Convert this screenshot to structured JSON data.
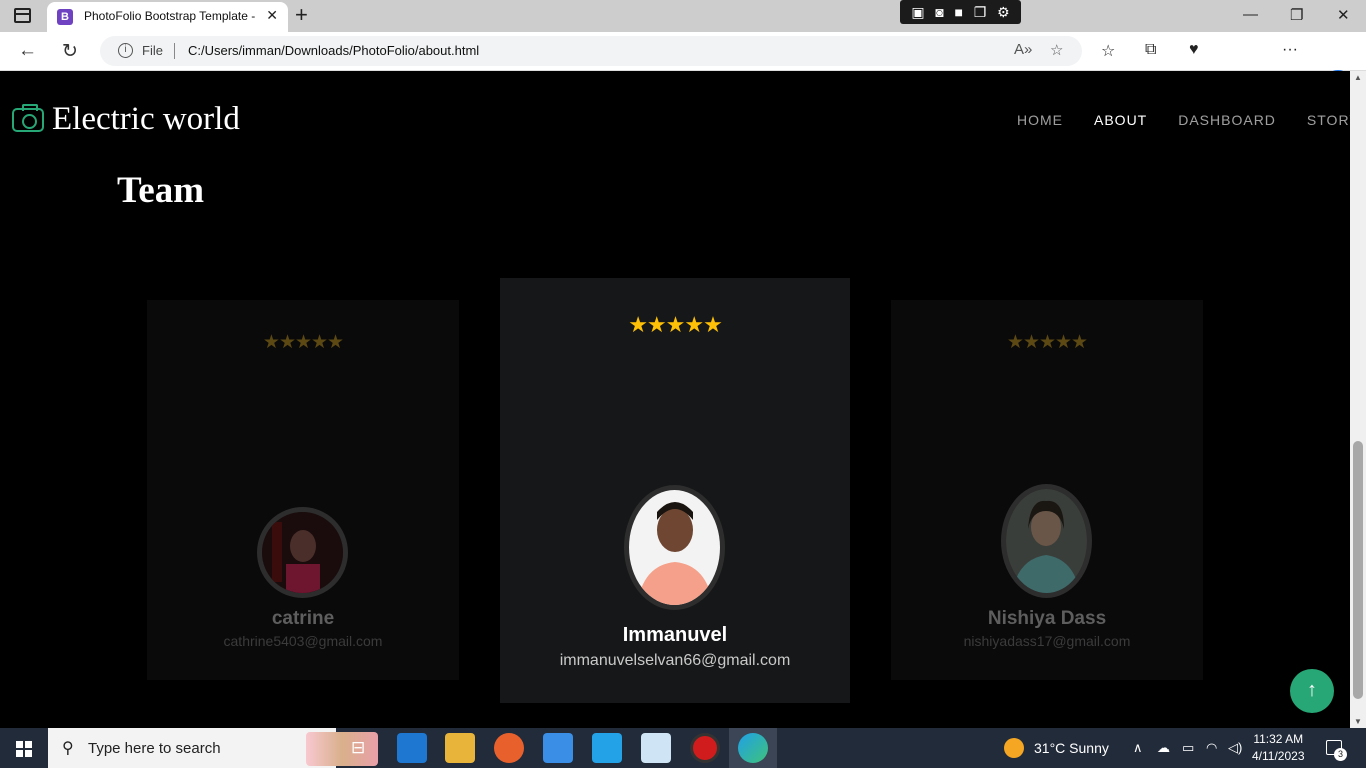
{
  "browser": {
    "tab_favicon": "B",
    "tab_title": "PhotoFolio Bootstrap Template -",
    "tab_close": "✕",
    "new_tab": "+",
    "capture_icons": [
      "file-camera-icon",
      "camera-icon",
      "video-icon",
      "window-icon",
      "gear-icon"
    ],
    "file_label": "File",
    "url": "C:/Users/imman/Downloads/PhotoFolio/about.html"
  },
  "site": {
    "brand": "Electric world",
    "nav": [
      {
        "label": "HOME",
        "active": false
      },
      {
        "label": "ABOUT",
        "active": true
      },
      {
        "label": "DASHBOARD",
        "active": false
      },
      {
        "label": "STORY",
        "active": false
      }
    ],
    "section_title": "Team",
    "team": [
      {
        "name": "catrine",
        "email": "cathrine5403@gmail.com",
        "stars": 5,
        "highlighted": false
      },
      {
        "name": "Immanuvel",
        "email": "immanuvelselvan66@gmail.com",
        "stars": 5,
        "highlighted": true
      },
      {
        "name": "Nishiya Dass",
        "email": "nishiyadass17@gmail.com",
        "stars": 5,
        "highlighted": false
      }
    ],
    "star_glyphs": "★★★★★",
    "back_to_top": "↑",
    "accent_color": "#27a776",
    "star_color": "#ffc107"
  },
  "taskbar": {
    "search_placeholder": "Type here to search",
    "weather": "31°C  Sunny",
    "time": "11:32 AM",
    "date": "4/11/2023",
    "notification_count": "3"
  }
}
